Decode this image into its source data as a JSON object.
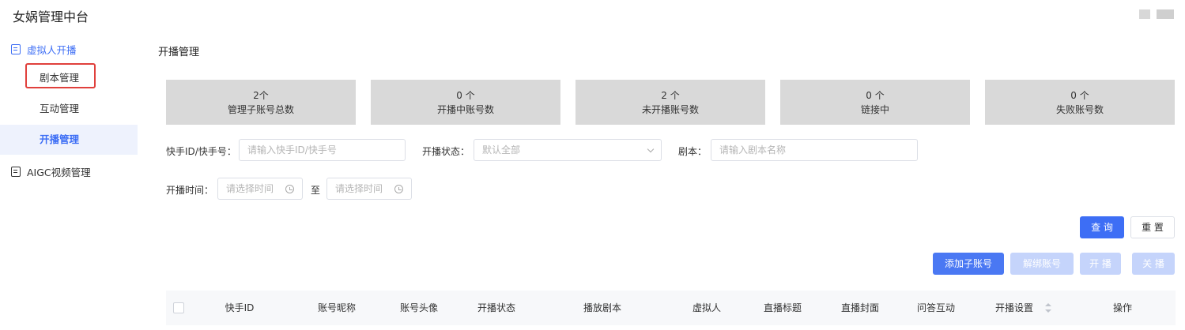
{
  "app": {
    "title": "女娲管理中台"
  },
  "sidebar": {
    "group1": "虚拟人开播",
    "items": [
      {
        "label": "剧本管理"
      },
      {
        "label": "互动管理"
      },
      {
        "label": "开播管理"
      }
    ],
    "group2": "AIGC视频管理"
  },
  "page": {
    "title": "开播管理"
  },
  "stats": [
    {
      "value": "2个",
      "label": "管理子账号总数"
    },
    {
      "value": "0 个",
      "label": "开播中账号数"
    },
    {
      "value": "2 个",
      "label": "未开播账号数"
    },
    {
      "value": "0 个",
      "label": "链接中"
    },
    {
      "value": "0 个",
      "label": "失败账号数"
    }
  ],
  "filters": {
    "account_label": "快手ID/快手号：",
    "account_placeholder": "请输入快手ID/快手号",
    "status_label": "开播状态：",
    "status_value": "默认全部",
    "script_label": "剧本：",
    "script_placeholder": "请输入剧本名称",
    "time_label": "开播时间：",
    "time_start_placeholder": "请选择时间",
    "time_sep": "至",
    "time_end_placeholder": "请选择时间"
  },
  "buttons": {
    "query": "查 询",
    "reset": "重 置",
    "add_sub_account": "添加子账号",
    "unbind": "解绑账号",
    "start": "开 播",
    "stop": "关 播"
  },
  "table": {
    "columns": [
      "快手ID",
      "账号昵称",
      "账号头像",
      "开播状态",
      "播放剧本",
      "虚拟人",
      "直播标题",
      "直播封面",
      "问答互动",
      "开播设置",
      "操作"
    ]
  },
  "colors": {
    "accent": "#3d6ef5",
    "stat_card_bg": "#d9d9d9",
    "highlight_border": "#e0403c"
  }
}
